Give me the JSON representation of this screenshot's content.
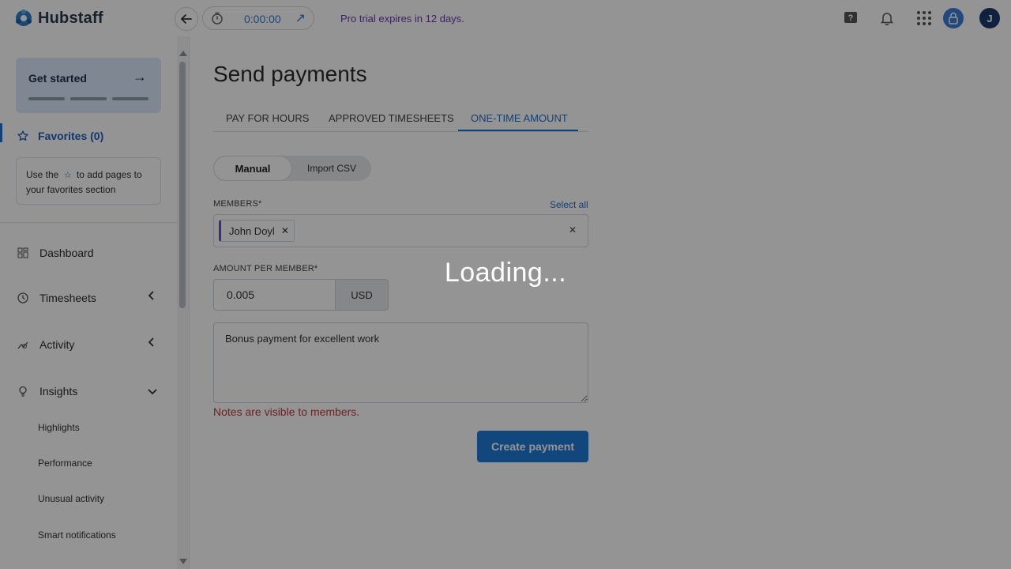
{
  "brand": {
    "name": "Hubstaff",
    "accent_color": "#1f6fd1"
  },
  "topbar": {
    "timer_value": "0:00:00",
    "trial_text": "Pro trial expires in 12 days.",
    "avatar_initial": "J",
    "icons": [
      "help-icon",
      "bell-icon",
      "apps-grid-icon",
      "lock-avatar-icon"
    ]
  },
  "sidebar": {
    "get_started": "Get started",
    "favorites": "Favorites (0)",
    "favorites_help_before": "Use the",
    "favorites_help_after": "to add pages to your favorites section",
    "items": [
      {
        "label": "Dashboard"
      },
      {
        "label": "Timesheets"
      },
      {
        "label": "Activity"
      },
      {
        "label": "Insights"
      }
    ],
    "subitems": [
      "Highlights",
      "Performance",
      "Unusual activity",
      "Smart notifications"
    ]
  },
  "main": {
    "title": "Send payments",
    "tabs": [
      {
        "label": "PAY FOR HOURS"
      },
      {
        "label": "APPROVED TIMESHEETS"
      },
      {
        "label": "ONE-TIME AMOUNT"
      }
    ],
    "mode": {
      "manual": "Manual",
      "import": "Import CSV"
    },
    "members_label": "MEMBERS*",
    "select_all": "Select all",
    "member_chip": "John Doyl",
    "amount_label": "AMOUNT PER MEMBER*",
    "amount_value": "0.005",
    "currency": "USD",
    "notes_value": "Bonus payment for excellent work",
    "notes_hint": "Notes are visible to members.",
    "create_button": "Create payment"
  },
  "overlay": {
    "loading_text": "Loading..."
  }
}
